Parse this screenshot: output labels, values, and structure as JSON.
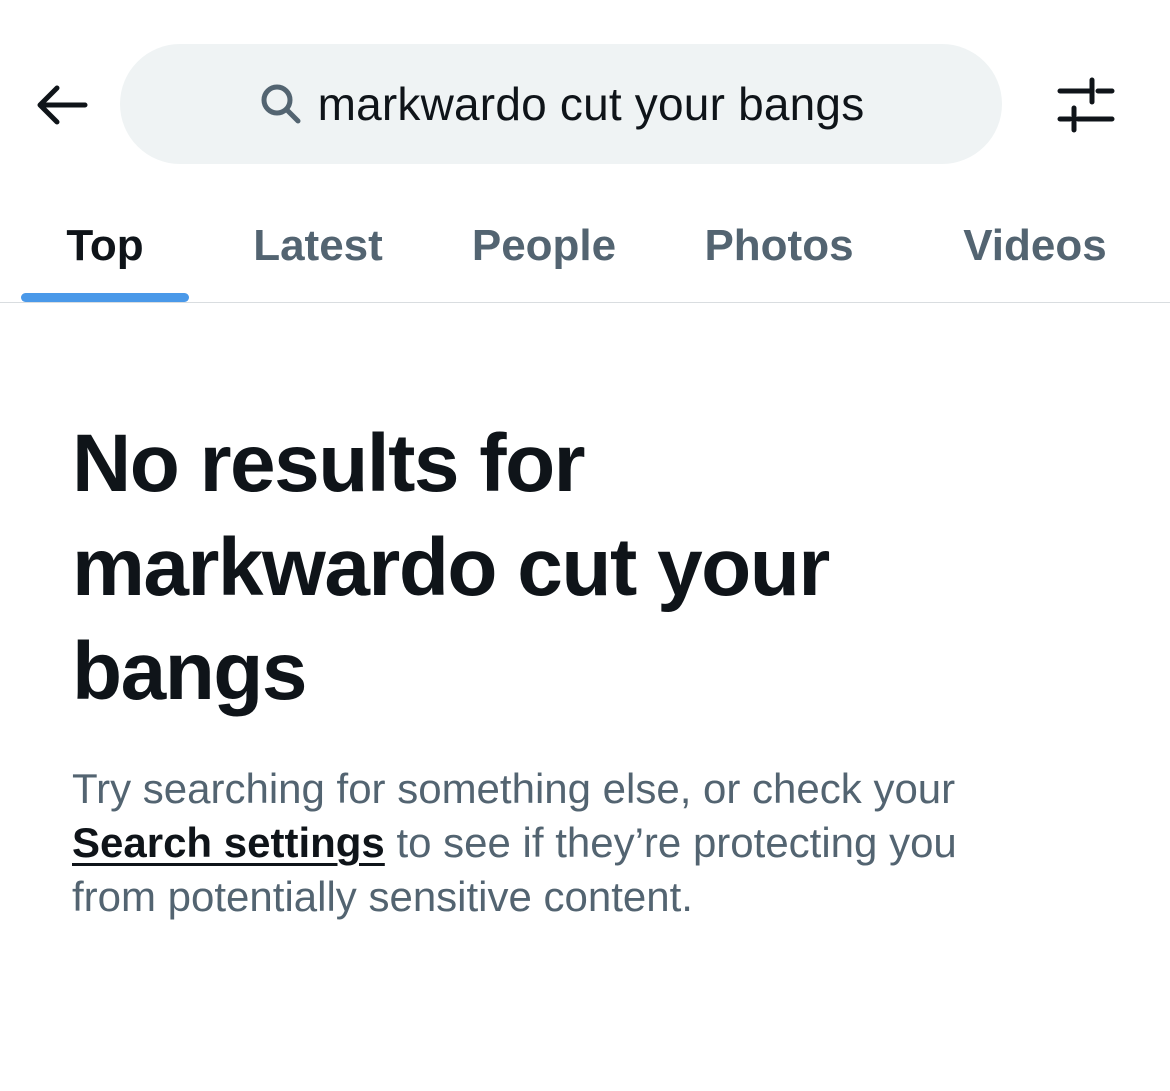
{
  "header": {
    "back_icon": "arrow-left-icon",
    "search": {
      "icon": "search-icon",
      "query": "markwardo cut your bangs"
    },
    "filter_icon": "sliders-icon"
  },
  "tabs": [
    {
      "label": "Top",
      "active": true
    },
    {
      "label": "Latest",
      "active": false
    },
    {
      "label": "People",
      "active": false
    },
    {
      "label": "Photos",
      "active": false
    },
    {
      "label": "Videos",
      "active": false
    }
  ],
  "empty_state": {
    "title_prefix": "No results for",
    "title_query": "markwardo cut your bangs",
    "desc_before": "Try searching for something else, or check your ",
    "desc_link": "Search settings",
    "desc_after": " to see if they’re protecting you from potentially sensitive content."
  },
  "colors": {
    "accent": "#4a99e9",
    "text_primary": "#0f1419",
    "text_secondary": "#536471",
    "search_bg": "#eff3f4"
  }
}
